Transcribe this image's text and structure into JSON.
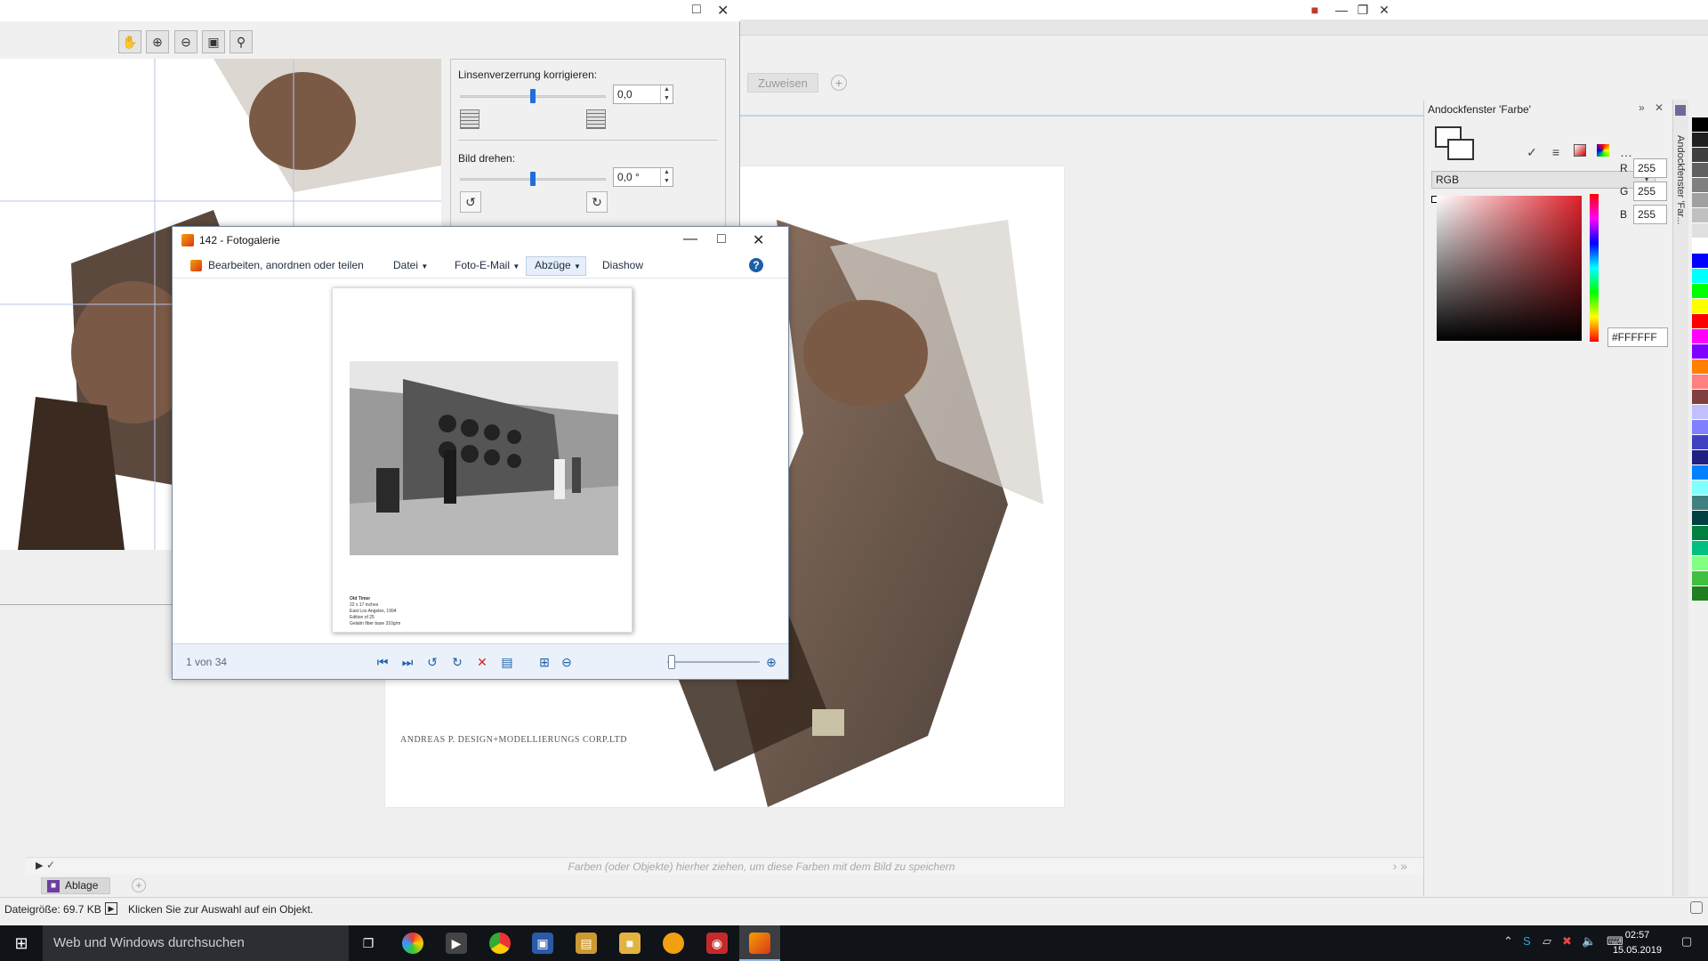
{
  "lens_window": {
    "toolbar_icons": [
      "hand-icon",
      "zoom-in-icon",
      "zoom-out-icon",
      "fit-icon",
      "zoom-100-icon"
    ],
    "lens_label": "Linsenverzerrung korrigieren:",
    "lens_value": "0,0",
    "lens_slider_fraction": 0.5,
    "rotate_label": "Bild drehen:",
    "rotate_value": "0,0 °",
    "rotate_slider_fraction": 0.5
  },
  "app": {
    "doc_tab": "Zuweisen",
    "watermark": "ANDREAS P. DESIGN+MODELLIERUNGS CORP.LTD",
    "palette_hint": "Farben (oder Objekte) hierher ziehen, um diese Farben mit dem Bild zu speichern",
    "page_tab": "Ablage",
    "status_size": "Dateigröße: 69.7 KB",
    "status_hint": "Klicken Sie zur Auswahl auf ein Objekt."
  },
  "docker": {
    "title": "Andockfenster 'Farbe'",
    "side_label": "Andockfenster 'Far...",
    "mode": "RGB",
    "r_label": "R",
    "r": "255",
    "g_label": "G",
    "g": "255",
    "b_label": "B",
    "b": "255",
    "hex": "#FFFFFF",
    "palette_colors": [
      "#000000",
      "#202020",
      "#404040",
      "#606060",
      "#808080",
      "#a0a0a0",
      "#c0c0c0",
      "#e0e0e0",
      "#ffffff",
      "#0000ff",
      "#00ffff",
      "#00ff00",
      "#ffff00",
      "#ff0000",
      "#ff00ff",
      "#8000ff",
      "#ff8000",
      "#ff8080",
      "#804040",
      "#c0c0ff",
      "#8080ff",
      "#4040c0",
      "#202080",
      "#0080ff",
      "#80ffff",
      "#408080",
      "#004040",
      "#008040",
      "#00c080",
      "#80ff80",
      "#40c040",
      "#208020"
    ]
  },
  "gallery": {
    "title": "142 - Fotogalerie",
    "menu": {
      "edit": "Bearbeiten, anordnen oder teilen",
      "file": "Datei",
      "email": "Foto-E-Mail",
      "prints": "Abzüge",
      "slideshow": "Diashow"
    },
    "caption": [
      "Old Timer",
      "22 x 17 inches",
      "East Los Angeles, 1994",
      "Edition of 25",
      "Gelatin fiber base 310g/m"
    ],
    "counter": "1 von 34",
    "zoom_fraction": 0.05
  },
  "taskbar": {
    "search_placeholder": "Web und Windows durchsuchen",
    "time": "02:57",
    "date": "15.05.2019"
  }
}
